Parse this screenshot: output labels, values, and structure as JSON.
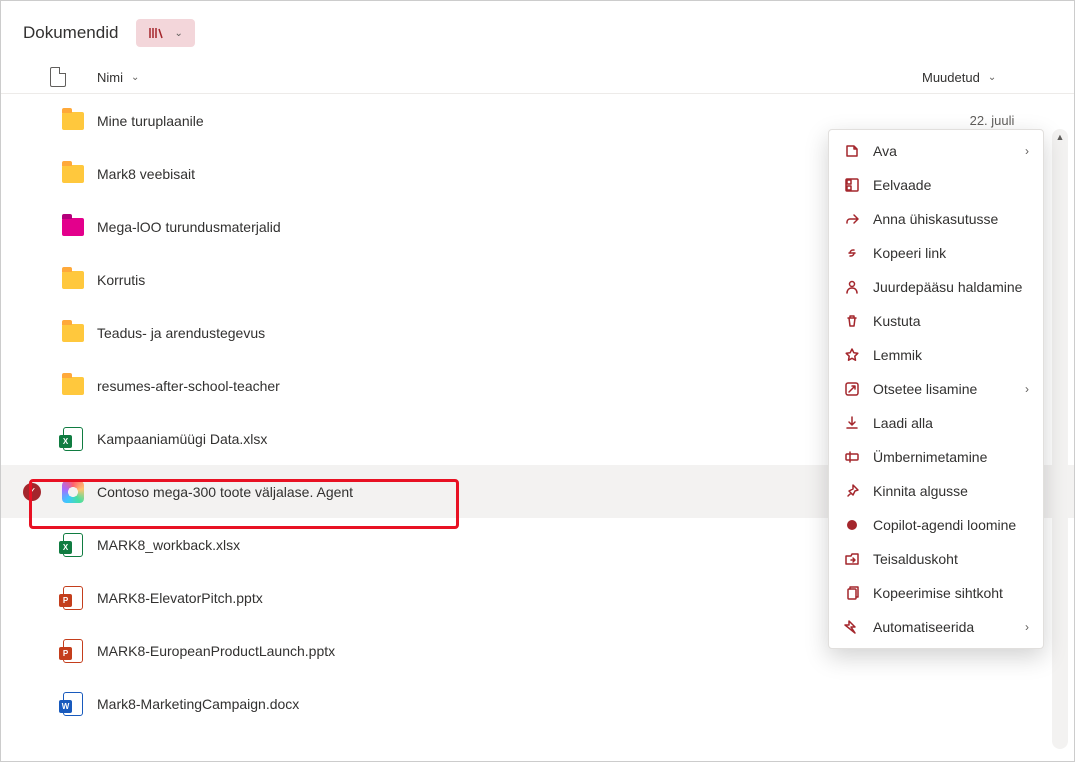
{
  "page": {
    "title": "Dokumendid"
  },
  "columns": {
    "name": "Nimi",
    "modified": "Muudetud"
  },
  "rows": [
    {
      "icon": "folder-yellow",
      "name": "Mine turuplaanile",
      "modified": "22. juuli"
    },
    {
      "icon": "folder-yellow",
      "name": "Mark8 veebisait",
      "modified": ""
    },
    {
      "icon": "folder-magenta",
      "name": "Mega-lOO turundusmaterjalid",
      "modified": ""
    },
    {
      "icon": "folder-yellow",
      "name": "Korrutis",
      "modified": ""
    },
    {
      "icon": "folder-yellow",
      "name": "Teadus- ja arendustegevus",
      "modified": ""
    },
    {
      "icon": "folder-yellow",
      "name": "resumes-after-school-teacher",
      "modified": ""
    },
    {
      "icon": "excel",
      "name": "Kampaaniamüügi Data.xlsx",
      "modified": ""
    },
    {
      "icon": "copilot",
      "name": "Contoso mega-300 toote väljalase. Agent",
      "modified": "",
      "selected": true,
      "showMore": true
    },
    {
      "icon": "excel",
      "name": "MARK8_workback.xlsx",
      "modified": ""
    },
    {
      "icon": "ppt",
      "name": "MARK8-ElevatorPitch.pptx",
      "modified": ""
    },
    {
      "icon": "ppt",
      "name": "MARK8-EuropeanProductLaunch.pptx",
      "modified": ""
    },
    {
      "icon": "word",
      "name": "Mark8-MarketingCampaign.docx",
      "modified": ""
    }
  ],
  "menu": {
    "items": [
      {
        "icon": "open",
        "label": "Ava",
        "sub": true
      },
      {
        "icon": "preview",
        "label": "Eelvaade"
      },
      {
        "icon": "share",
        "label": "Anna ühiskasutusse"
      },
      {
        "icon": "link",
        "label": "Kopeeri link"
      },
      {
        "icon": "access",
        "label": "Juurdepääsu haldamine"
      },
      {
        "icon": "delete",
        "label": "Kustuta"
      },
      {
        "icon": "favorite",
        "label": "Lemmik"
      },
      {
        "icon": "shortcut",
        "label": "Otsetee lisamine",
        "sub": true
      },
      {
        "icon": "download",
        "label": "Laadi alla"
      },
      {
        "icon": "rename",
        "label": "Ümbernimetamine"
      },
      {
        "icon": "pin",
        "label": "Kinnita algusse"
      },
      {
        "icon": "copilot",
        "label": "Copilot-agendi loomine"
      },
      {
        "icon": "move",
        "label": "Teisalduskoht"
      },
      {
        "icon": "copy",
        "label": "Kopeerimise sihtkoht"
      },
      {
        "icon": "automate",
        "label": "Automatiseerida",
        "sub": true
      }
    ]
  }
}
